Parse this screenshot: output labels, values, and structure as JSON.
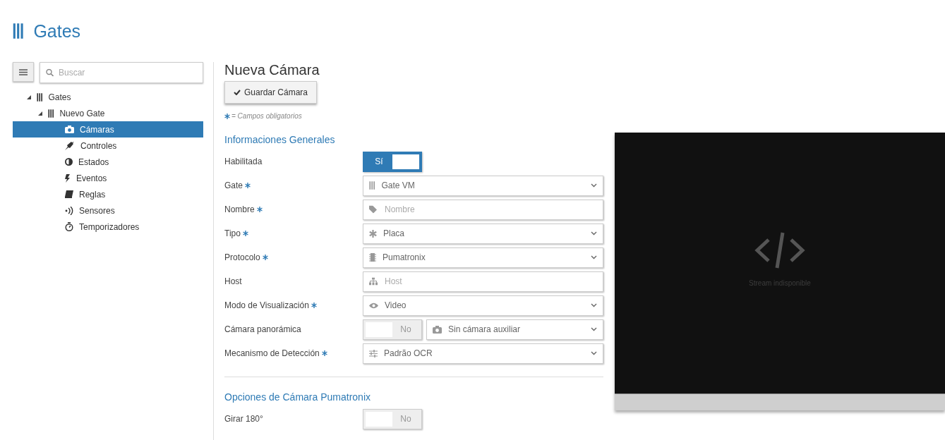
{
  "header": {
    "title": "Gates"
  },
  "sidebar": {
    "search": {
      "placeholder": "Buscar"
    },
    "tree": [
      {
        "label": "Gates",
        "expanded": true,
        "selected": false,
        "children": [
          {
            "label": "Nuevo Gate",
            "expanded": true,
            "selected": false,
            "children": [
              {
                "label": "Cámaras",
                "selected": true
              },
              {
                "label": "Controles",
                "selected": false
              },
              {
                "label": "Estados",
                "selected": false
              },
              {
                "label": "Eventos",
                "selected": false
              },
              {
                "label": "Reglas",
                "selected": false
              },
              {
                "label": "Sensores",
                "selected": false
              },
              {
                "label": "Temporizadores",
                "selected": false
              }
            ]
          }
        ]
      }
    ]
  },
  "form": {
    "title": "Nueva Cámara",
    "save_button": "Guardar Cámara",
    "required_note": "= Campos obligatorios",
    "sections": [
      {
        "title": "Informaciones Generales",
        "fields": [
          {
            "kind": "toggle",
            "label": "Habilitada",
            "required": false,
            "on": true,
            "text": "Sí"
          },
          {
            "kind": "select",
            "label": "Gate",
            "required": true,
            "value": "Gate VM"
          },
          {
            "kind": "text",
            "label": "Nombre",
            "required": true,
            "placeholder": "Nombre"
          },
          {
            "kind": "select",
            "label": "Tipo",
            "required": true,
            "value": "Placa"
          },
          {
            "kind": "select",
            "label": "Protocolo",
            "required": true,
            "value": "Pumatronix"
          },
          {
            "kind": "text",
            "label": "Host",
            "required": false,
            "placeholder": "Host"
          },
          {
            "kind": "select",
            "label": "Modo de Visualización",
            "required": true,
            "value": "Video"
          },
          {
            "kind": "toggle_select",
            "label": "Cámara panorámica",
            "required": false,
            "on": false,
            "text": "No",
            "value": "Sin cámara auxiliar"
          },
          {
            "kind": "select",
            "label": "Mecanismo de Detección",
            "required": true,
            "value": "Padrão OCR"
          }
        ]
      },
      {
        "title": "Opciones de Cámara Pumatronix",
        "fields": [
          {
            "kind": "toggle",
            "label": "Girar 180°",
            "required": false,
            "on": false,
            "text": "No"
          }
        ]
      }
    ]
  },
  "video": {
    "message": "Stream indisponible"
  }
}
